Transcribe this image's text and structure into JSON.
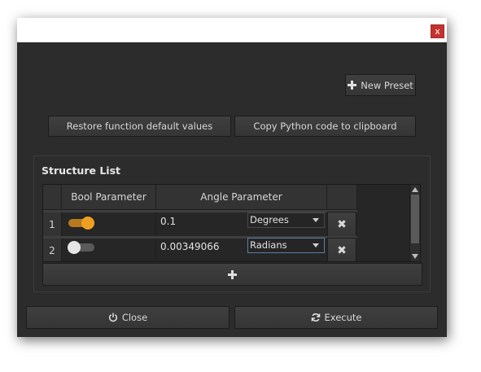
{
  "window": {
    "close_glyph": "x"
  },
  "toolbar": {
    "new_preset_label": "New Preset",
    "restore_label": "Restore function default values",
    "copy_label": "Copy Python code to clipboard"
  },
  "structure_list": {
    "title": "Structure List",
    "columns": [
      "Bool Parameter",
      "Angle Parameter"
    ],
    "rows": [
      {
        "index": "1",
        "bool": true,
        "angle": "0.1",
        "unit": "Degrees"
      },
      {
        "index": "2",
        "bool": false,
        "angle": "0.00349066",
        "unit": "Radians"
      }
    ]
  },
  "footer": {
    "close_label": "Close",
    "execute_label": "Execute"
  },
  "colors": {
    "accent": "#f0a020",
    "background": "#2c2c2c",
    "close_red": "#c4322f"
  },
  "icons": [
    "plus-icon",
    "power-icon",
    "refresh-icon",
    "delete-icon",
    "close-icon"
  ]
}
